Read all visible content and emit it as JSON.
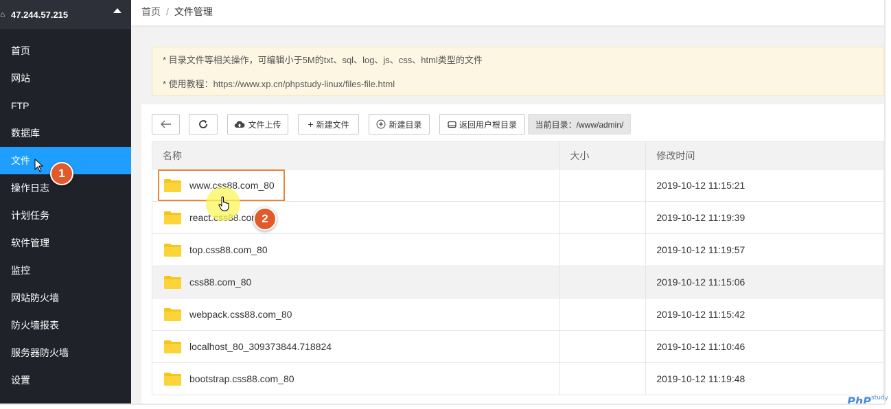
{
  "sidebar": {
    "server_ip": "47.244.57.215",
    "items": [
      {
        "label": "首页"
      },
      {
        "label": "网站"
      },
      {
        "label": "FTP"
      },
      {
        "label": "数据库"
      },
      {
        "label": "文件"
      },
      {
        "label": "操作日志"
      },
      {
        "label": "计划任务"
      },
      {
        "label": "软件管理"
      },
      {
        "label": "监控"
      },
      {
        "label": "网站防火墙"
      },
      {
        "label": "防火墙报表"
      },
      {
        "label": "服务器防火墙"
      },
      {
        "label": "设置"
      }
    ],
    "active_index": 4
  },
  "breadcrumb": {
    "home": "首页",
    "separator": "/",
    "current": "文件管理"
  },
  "notice": {
    "line1": "* 目录文件等相关操作，可编辑小于5M的txt、sql、log、js、css、html类型的文件",
    "line2": "* 使用教程：https://www.xp.cn/phpstudy-linux/files-file.html"
  },
  "toolbar": {
    "back_icon": "arrow-left-icon",
    "refresh_icon": "refresh-icon",
    "upload_label": "文件上传",
    "new_file_label": "新建文件",
    "new_dir_label": "新建目录",
    "home_dir_label": "返回用户根目录",
    "current_dir": "当前目录：/www/admin/"
  },
  "table": {
    "headers": {
      "name": "名称",
      "size": "大小",
      "modified": "修改时间"
    },
    "rows": [
      {
        "name": "www.css88.com_80",
        "size": "",
        "modified": "2019-10-12 11:15:21"
      },
      {
        "name": "react.css88.com_80",
        "size": "",
        "modified": "2019-10-12 11:19:39"
      },
      {
        "name": "top.css88.com_80",
        "size": "",
        "modified": "2019-10-12 11:19:57"
      },
      {
        "name": "css88.com_80",
        "size": "",
        "modified": "2019-10-12 11:15:06"
      },
      {
        "name": "webpack.css88.com_80",
        "size": "",
        "modified": "2019-10-12 11:15:42"
      },
      {
        "name": "localhost_80_309373844.718824",
        "size": "",
        "modified": "2019-10-12 11:10:46"
      },
      {
        "name": "bootstrap.css88.com_80",
        "size": "",
        "modified": "2019-10-12 11:19:48"
      }
    ]
  },
  "annotations": {
    "step1": "1",
    "step2": "2"
  },
  "watermark": {
    "brand": "PhP",
    "sub": "study"
  },
  "colors": {
    "sidebar_bg": "#20222a",
    "active": "#1e9fff",
    "folder": "#f5c518",
    "badge": "#e05a2a",
    "highlight_border": "#ee8434"
  }
}
